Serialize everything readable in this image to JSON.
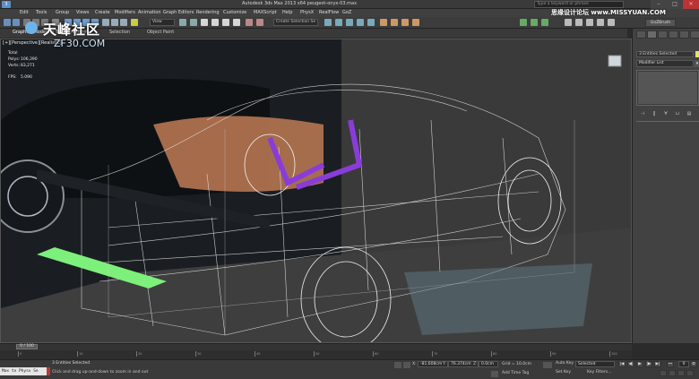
{
  "titlebar": {
    "app_icon": "max-logo-icon",
    "title": "Autodesk 3ds Max 2013 x64    peugeot-onyx-03.max",
    "search_placeholder": "Type a keyword or phrase",
    "minimize": "–",
    "maximize": "□",
    "close": "✕"
  },
  "menu": {
    "items": [
      "Edit",
      "Tools",
      "Group",
      "Views",
      "Create",
      "Modifiers",
      "Animation",
      "Graph Editors",
      "Rendering",
      "Customize",
      "MAXScript",
      "Help",
      "PhysX",
      "RealFlow",
      "GoZ"
    ]
  },
  "toolbar": {
    "selection_set": "View",
    "named_selection": "Create Selection Se",
    "gobrush": "GoZBrush"
  },
  "ribbon": {
    "tabs": [
      "Graphite Modeling Tools",
      "Freeform",
      "Selection",
      "Object Paint"
    ]
  },
  "viewport": {
    "label": "[+][Perspective][Realistic]",
    "stats": {
      "total_label": "Total",
      "polys_label": "Polys:",
      "polys_value": "106,390",
      "verts_label": "Verts:",
      "verts_value": "83,271",
      "fps_label": "FPS:",
      "fps_value": "5.090"
    },
    "colors": {
      "wireframe": "#ffffff",
      "accent_green": "#7cf07a",
      "accent_purple": "#8a3cd8",
      "car_orange": "#c07b55"
    }
  },
  "command_panel": {
    "selection": "3 Entities Selected",
    "selection_color": "#e0e26a",
    "modifier_list": "Modifier List",
    "stack_buttons": [
      "pin-stack-icon",
      "show-end-result-icon",
      "make-unique-icon",
      "remove-modifier-icon",
      "configure-sets-icon"
    ]
  },
  "timeline": {
    "thumb": "0 / 100",
    "ticks": [
      "0",
      "10",
      "20",
      "30",
      "40",
      "50",
      "60",
      "70",
      "80",
      "90",
      "100"
    ]
  },
  "status": {
    "maxscript": "Max to Physx Se",
    "selected": "3 Entities Selected",
    "prompt": "Click and drag up-and-down to zoom in and out",
    "x_label": "X:",
    "x_value": "-81.608cm",
    "y_label": "Y:",
    "y_value": "76.374cm",
    "z_label": "Z:",
    "z_value": "0.0cm",
    "grid": "Grid = 10.0cm",
    "add_time_tag": "Add Time Tag",
    "auto_key": "Auto Key",
    "auto_key_value": "Selected",
    "set_key": "Set Key",
    "key_filters": "Key Filters...",
    "frame": "0"
  },
  "watermark": {
    "logo_cn": "天峰社区",
    "logo_en": "ZF30.COM",
    "right_cn": "思缘设计论坛 www.MISSYUAN.COM"
  }
}
